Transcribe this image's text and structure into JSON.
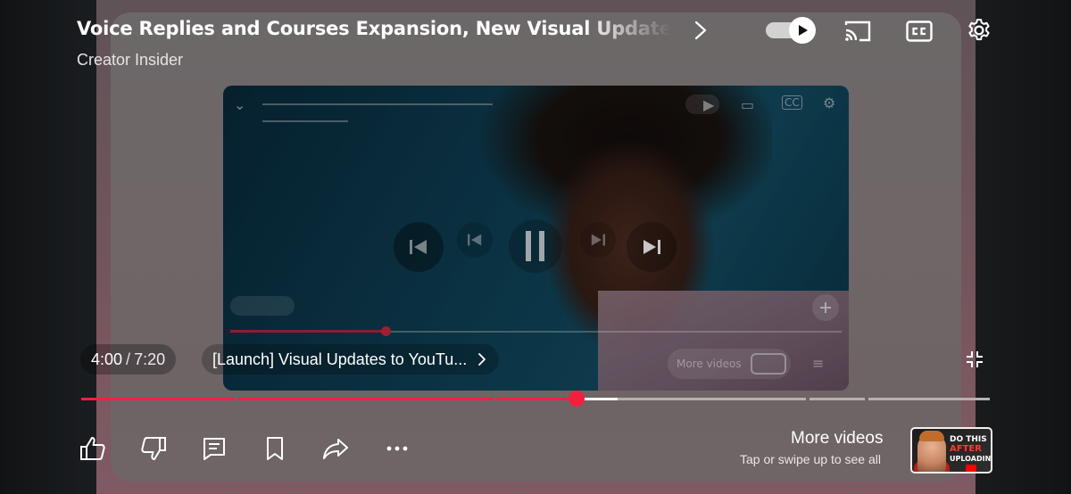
{
  "video": {
    "title": "Voice Replies and Courses Expansion, New Visual Updates, A",
    "channel": "Creator Insider"
  },
  "player": {
    "current_time": "4:00",
    "separator": "/",
    "duration": "7:20",
    "progress_fraction": 0.545,
    "chapter_title": "[Launch] Visual Updates to YouTu..."
  },
  "preview": {
    "more_videos_label": "More videos"
  },
  "top_controls": {
    "autoplay_on": true,
    "icons": [
      "chevron-right-icon",
      "autoplay-toggle",
      "cast-icon",
      "captions-icon",
      "settings-icon"
    ]
  },
  "actions": {
    "icons": [
      "like-icon",
      "dislike-icon",
      "comments-icon",
      "save-icon",
      "share-icon",
      "more-icon"
    ]
  },
  "more_videos": {
    "title": "More videos",
    "subtitle": "Tap or swipe up to see all",
    "thumbnail_text": [
      "DO THIS",
      "AFTER",
      "UPLOADING"
    ]
  },
  "colors": {
    "progress": "#f2203e",
    "buffered": "#ffffff",
    "track": "#b8afb2"
  }
}
